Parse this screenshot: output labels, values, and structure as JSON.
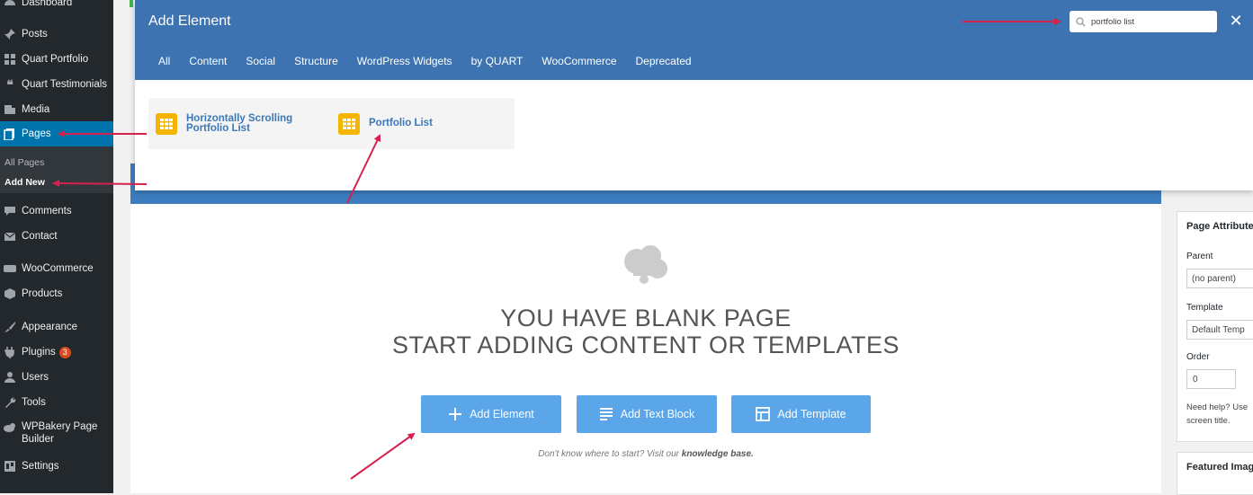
{
  "sidebar": {
    "items": [
      {
        "label": "Dashboard",
        "icon": "dashboard-icon"
      },
      {
        "label": "Posts",
        "icon": "pin-icon"
      },
      {
        "label": "Quart Portfolio",
        "icon": "grid-icon"
      },
      {
        "label": "Quart Testimonials",
        "icon": "quote-icon"
      },
      {
        "label": "Media",
        "icon": "media-icon"
      },
      {
        "label": "Pages",
        "icon": "pages-icon"
      },
      {
        "label": "Comments",
        "icon": "comment-icon"
      },
      {
        "label": "Contact",
        "icon": "mail-icon"
      },
      {
        "label": "WooCommerce",
        "icon": "woo-icon"
      },
      {
        "label": "Products",
        "icon": "box-icon"
      },
      {
        "label": "Appearance",
        "icon": "brush-icon"
      },
      {
        "label": "Plugins",
        "icon": "plug-icon",
        "badge": "3"
      },
      {
        "label": "Users",
        "icon": "user-icon"
      },
      {
        "label": "Tools",
        "icon": "wrench-icon"
      },
      {
        "label": "WPBakery Page Builder",
        "icon": "wpbakery-icon"
      },
      {
        "label": "Settings",
        "icon": "settings-icon"
      }
    ],
    "submenu": {
      "all_pages": "All Pages",
      "add_new": "Add New"
    }
  },
  "modal": {
    "title": "Add Element",
    "search_value": "portfolio list",
    "close_label": "✕",
    "tabs": [
      "All",
      "Content",
      "Social",
      "Structure",
      "WordPress Widgets",
      "by QUART",
      "WooCommerce",
      "Deprecated"
    ],
    "results": [
      {
        "name": "Horizontally Scrolling Portfolio List"
      },
      {
        "name": "Portfolio List"
      }
    ]
  },
  "canvas": {
    "title_line1": "YOU HAVE BLANK PAGE",
    "title_line2": "START ADDING CONTENT OR TEMPLATES",
    "buttons": {
      "add_element": "Add Element",
      "add_text_block": "Add Text Block",
      "add_template": "Add Template"
    },
    "help_prefix": "Don't know where to start? Visit our ",
    "help_link": "knowledge base.",
    "button_color": "#5aa6e8"
  },
  "right_panel": {
    "page_attributes_title": "Page Attribute",
    "parent_label": "Parent",
    "parent_value": "(no parent)",
    "template_label": "Template",
    "template_value": "Default Temp",
    "order_label": "Order",
    "order_value": "0",
    "help_line1": "Need help? Use",
    "help_line2": "screen title.",
    "featured_image_title": "Featured Imag"
  },
  "colors": {
    "sidebar_bg": "#23282d",
    "active_menu": "#0073aa",
    "modal_header": "#3c73b0",
    "element_icon": "#f3b500",
    "annotation_arrow": "#d6204e"
  }
}
